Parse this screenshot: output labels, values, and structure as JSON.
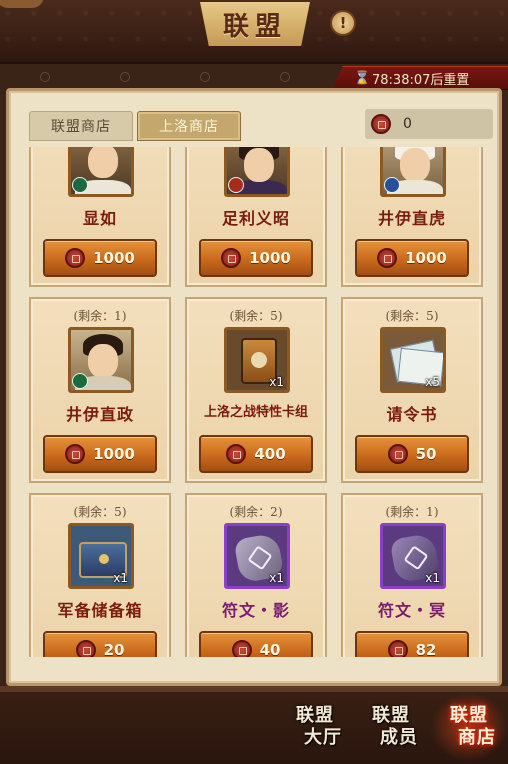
{
  "header": {
    "title": "联盟",
    "help_icon": "exclamation-icon"
  },
  "reset_timer": {
    "text": "78:38:07后重置",
    "icon": "hourglass-icon"
  },
  "tabs": [
    {
      "label": "联盟商店",
      "active": false
    },
    {
      "label": "上洛商店",
      "active": true
    }
  ],
  "currency": {
    "icon": "coin-icon",
    "amount": "0"
  },
  "items": [
    {
      "stock": "",
      "name": "显如",
      "price": "1000",
      "icon": "portrait-icon"
    },
    {
      "stock": "",
      "name": "足利义昭",
      "price": "1000",
      "icon": "portrait-icon"
    },
    {
      "stock": "",
      "name": "井伊直虎",
      "price": "1000",
      "icon": "portrait-icon"
    },
    {
      "stock": "(剩余：1)",
      "name": "井伊直政",
      "price": "1000",
      "icon": "portrait-icon"
    },
    {
      "stock": "(剩余：5)",
      "name": "上洛之战特性卡组",
      "price": "400",
      "qty": "x1",
      "icon": "card-pack-icon"
    },
    {
      "stock": "(剩余：5)",
      "name": "请令书",
      "price": "50",
      "qty": "x5",
      "icon": "scroll-icon"
    },
    {
      "stock": "(剩余：5)",
      "name": "军备储备箱",
      "price": "20",
      "qty": "x1",
      "icon": "chest-icon"
    },
    {
      "stock": "(剩余：2)",
      "name": "符文・影",
      "price": "40",
      "qty": "x1",
      "icon": "rune-icon"
    },
    {
      "stock": "(剩余：1)",
      "name": "符文・冥",
      "price": "82",
      "qty": "x1",
      "icon": "rune-icon"
    }
  ],
  "bottom_nav": [
    {
      "line1": "联盟",
      "line2": "大厅"
    },
    {
      "line1": "联盟",
      "line2": "成员"
    },
    {
      "line1": "联盟",
      "line2": "商店",
      "active": true
    }
  ],
  "colors": {
    "accent_red": "#7a1c0e",
    "button_orange": "#c96a1c",
    "panel_bg": "#eee2c6",
    "timer_bg": "#7a1612",
    "rune_frame_purple": "#8a3ec9"
  }
}
